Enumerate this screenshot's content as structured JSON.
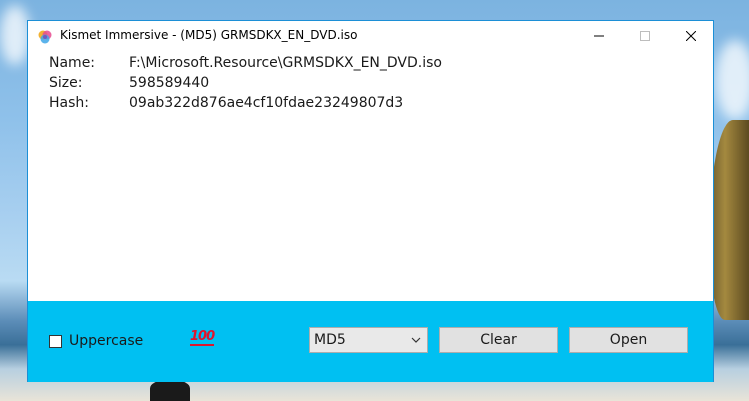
{
  "window": {
    "title": "Kismet Immersive - (MD5) GRMSDKX_EN_DVD.iso"
  },
  "info": {
    "name_label": "Name:",
    "name_value": "F:\\Microsoft.Resource\\GRMSDKX_EN_DVD.iso",
    "size_label": "Size:",
    "size_value": "598589440",
    "hash_label": "Hash:",
    "hash_value": "09ab322d876ae4cf10fdae23249807d3"
  },
  "controls": {
    "uppercase_label": "Uppercase",
    "uppercase_checked": false,
    "hundred_icon": "hundred-points-icon",
    "algorithm_selected": "MD5",
    "clear_label": "Clear",
    "open_label": "Open"
  },
  "colors": {
    "accent_bar": "#00c0f2",
    "window_border": "#1c8fd6"
  }
}
